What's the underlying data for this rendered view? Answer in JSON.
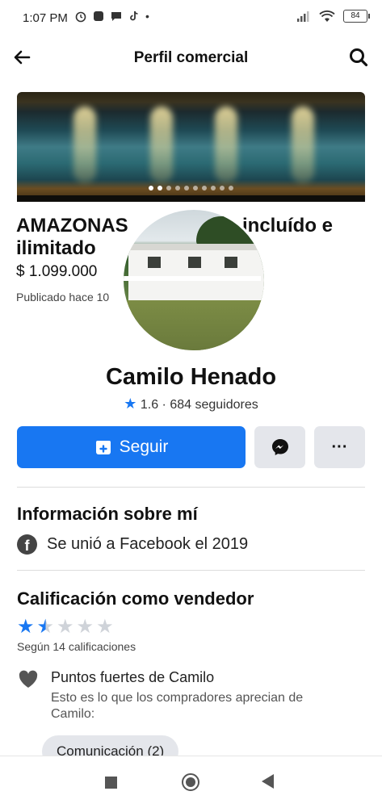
{
  "status_bar": {
    "time": "1:07 PM",
    "battery": "84"
  },
  "topbar": {
    "title": "Perfil comercial",
    "icons": [
      "back-arrow-icon",
      "search-icon"
    ]
  },
  "listing_preview": {
    "title_part1": "AMAZONAS",
    "title_part2": "incluído e",
    "title_line2": "ilimitado",
    "price": "$ 1.099.000",
    "published": "Publicado hace 10"
  },
  "profile": {
    "name": "Camilo Henado",
    "rating": "1.6",
    "followers": "· 684 seguidores"
  },
  "actions": {
    "follow_label": "Seguir"
  },
  "about": {
    "heading": "Información sobre mí",
    "joined": "Se unió a Facebook el 2019"
  },
  "seller_rating": {
    "heading": "Calificación como vendedor",
    "stars_value": 1.5,
    "stars_max": 5,
    "count_note": "Según 14 calificaciones",
    "strong_points_title": "Puntos fuertes de Camilo",
    "strong_points_sub": "Esto es lo que los compradores aprecian de Camilo:",
    "chip": "Comunicación (2)"
  },
  "colors": {
    "accent": "#1877f2",
    "button_grey": "#e4e6eb"
  }
}
